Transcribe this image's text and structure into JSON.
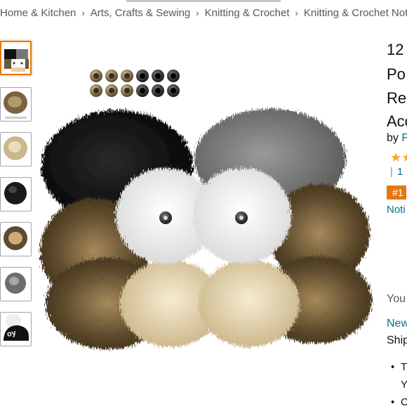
{
  "breadcrumb": [
    "Home & Kitchen",
    "Arts, Crafts & Sewing",
    "Knitting & Crochet",
    "Knitting & Crochet Notions"
  ],
  "breadcrumb_sep": "›",
  "title_lines": [
    "12",
    "Po",
    "Rei",
    "Acc"
  ],
  "byline": {
    "prefix": "by",
    "brand": "F"
  },
  "ratings": {
    "bar": "|",
    "count": "1"
  },
  "stars": "★★",
  "badge": "#1",
  "notice": "Noti",
  "save": "You",
  "new_link": "New",
  "ship": "Ship",
  "bullets": [
    {
      "bullet": "•",
      "text": "T"
    },
    {
      "bullet": "",
      "text": "Y"
    },
    {
      "bullet": "•",
      "text": "C"
    }
  ],
  "thumbnails": [
    "thumb-all-pompoms",
    "thumb-brown-pompom",
    "thumb-tan-pompom",
    "thumb-black-pompom",
    "thumb-brown-pompom-2",
    "thumb-gray-pompom",
    "thumb-hat-pompom"
  ],
  "hat_text": "oy",
  "colors": {
    "link": "#007185",
    "badge": "#e47911",
    "star": "#ffa41c",
    "selected_border": "#e77600"
  }
}
